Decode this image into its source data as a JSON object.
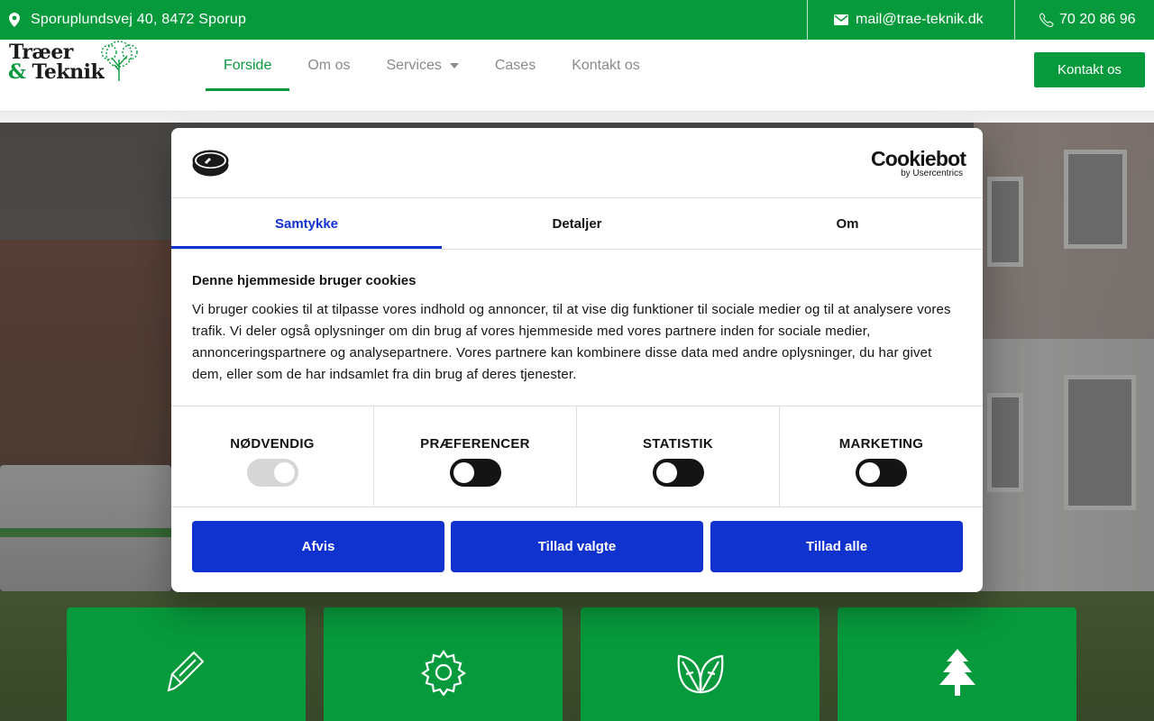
{
  "topbar": {
    "address": "Sporuplundsvej 40, 8472 Sporup",
    "email": "mail@trae-teknik.dk",
    "phone": "70 20 86 96"
  },
  "logo": {
    "line1": "Træer",
    "amp": "&",
    "line2": "Teknik"
  },
  "nav": {
    "items": [
      "Forside",
      "Om os",
      "Services",
      "Cases",
      "Kontakt os"
    ],
    "active": "Forside"
  },
  "header_cta": "Kontakt os",
  "cookie_dialog": {
    "brand": "Cookiebot",
    "brand_sub": "by Usercentrics",
    "tabs": [
      "Samtykke",
      "Detaljer",
      "Om"
    ],
    "active_tab": "Samtykke",
    "heading": "Denne hjemmeside bruger cookies",
    "text": "Vi bruger cookies til at tilpasse vores indhold og annoncer, til at vise dig funktioner til sociale medier og til at analysere vores trafik. Vi deler også oplysninger om din brug af vores hjemmeside med vores partnere inden for sociale medier, annonceringspartnere og analysepartnere. Vores partnere kan kombinere disse data med andre oplysninger, du har givet dem, eller som de har indsamlet fra din brug af deres tjenester.",
    "categories": [
      {
        "label": "NØDVENDIG",
        "state": "on-disabled"
      },
      {
        "label": "PRÆFERENCER",
        "state": "off"
      },
      {
        "label": "STATISTIK",
        "state": "off"
      },
      {
        "label": "MARKETING",
        "state": "off"
      }
    ],
    "buttons": [
      "Afvis",
      "Tillad valgte",
      "Tillad alle"
    ]
  },
  "service_cards": [
    {
      "icon": "saw-icon"
    },
    {
      "icon": "gear-icon"
    },
    {
      "icon": "leaves-icon"
    },
    {
      "icon": "tree-icon"
    }
  ],
  "colors": {
    "brand_green": "#079a3c",
    "cookiebot_blue": "#1032cf",
    "text_dark": "#141414"
  }
}
